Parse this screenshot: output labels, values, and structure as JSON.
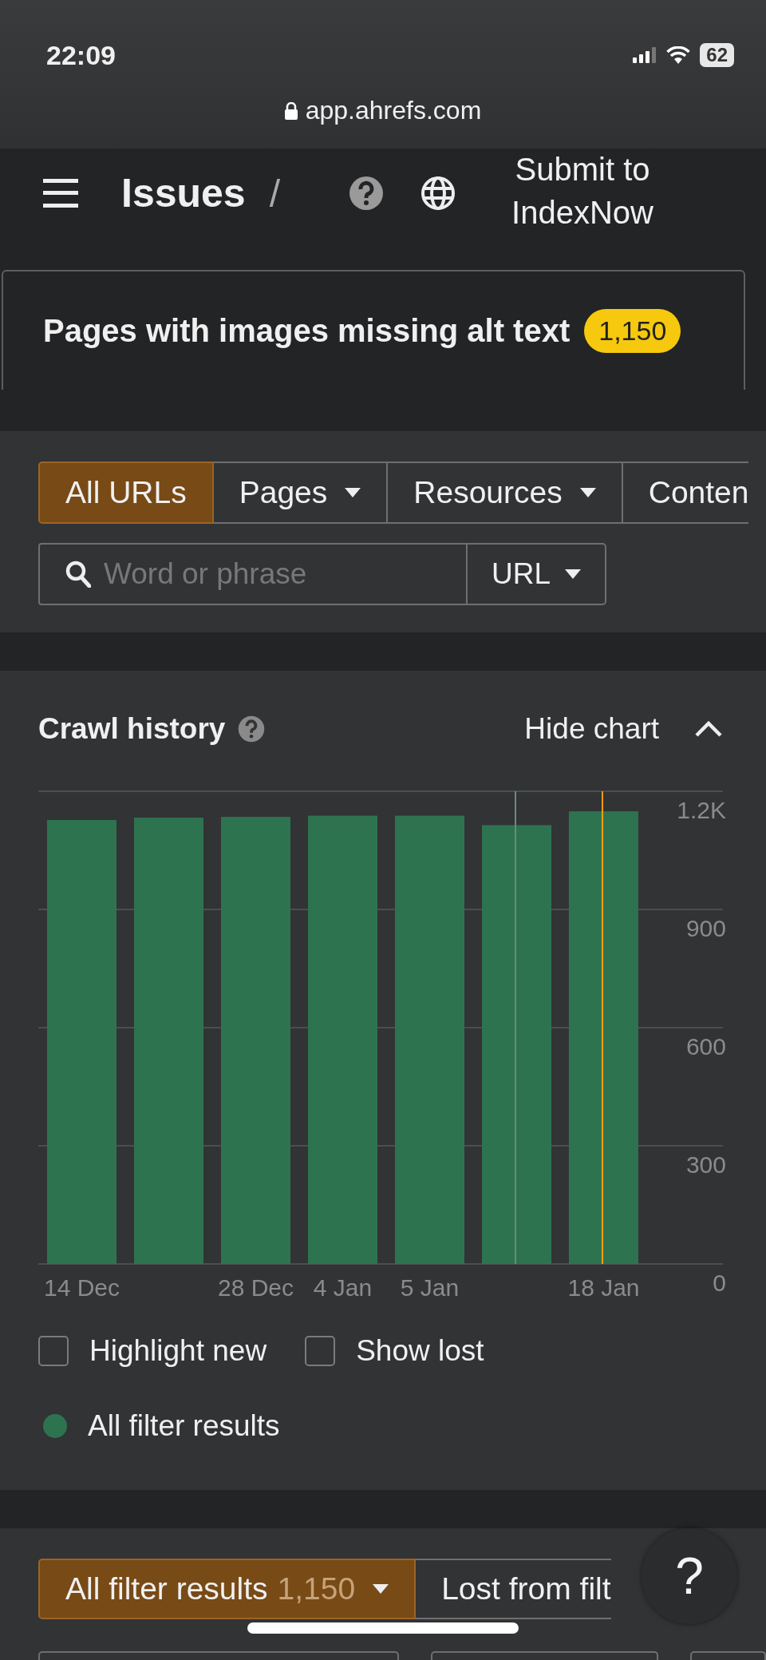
{
  "status_bar": {
    "time": "22:09",
    "battery": "62"
  },
  "address_bar": {
    "url": "app.ahrefs.com"
  },
  "header": {
    "title": "Issues",
    "separator": "/",
    "action": "Submit to IndexNow"
  },
  "issue_tab": {
    "title": "Pages with images missing alt text",
    "count": "1,150"
  },
  "filters": {
    "tabs": [
      {
        "label": "All URLs",
        "selected": true,
        "dropdown": false
      },
      {
        "label": "Pages",
        "selected": false,
        "dropdown": true
      },
      {
        "label": "Resources",
        "selected": false,
        "dropdown": true
      },
      {
        "label": "Conten",
        "selected": false,
        "dropdown": false
      }
    ],
    "search": {
      "placeholder": "Word or phrase"
    },
    "search_scope": "URL"
  },
  "crawl_history": {
    "title": "Crawl history",
    "toggle": "Hide chart",
    "chart_data": {
      "type": "bar",
      "values": [
        1127,
        1133,
        1135,
        1138,
        1138,
        1114,
        1149
      ],
      "color": "#2e7350",
      "categories": [
        "14 Dec",
        null,
        "28 Dec",
        "4 Jan",
        "5 Jan",
        null,
        "18 Jan"
      ],
      "ylim": [
        0,
        1200
      ],
      "yticks": [
        0,
        300,
        600,
        900,
        {
          "value": 1200,
          "label": "1.2K"
        }
      ],
      "grid": true
    },
    "options": [
      {
        "label": "Highlight new",
        "checked": false
      },
      {
        "label": "Show lost",
        "checked": false
      }
    ],
    "legend": [
      {
        "label": "All filter results",
        "color": "#2e7350"
      }
    ]
  },
  "result_tabs": [
    {
      "label": "All filter results",
      "count": "1,150",
      "selected": true
    },
    {
      "label": "Lost from filt",
      "selected": false
    }
  ],
  "help_button": "?"
}
